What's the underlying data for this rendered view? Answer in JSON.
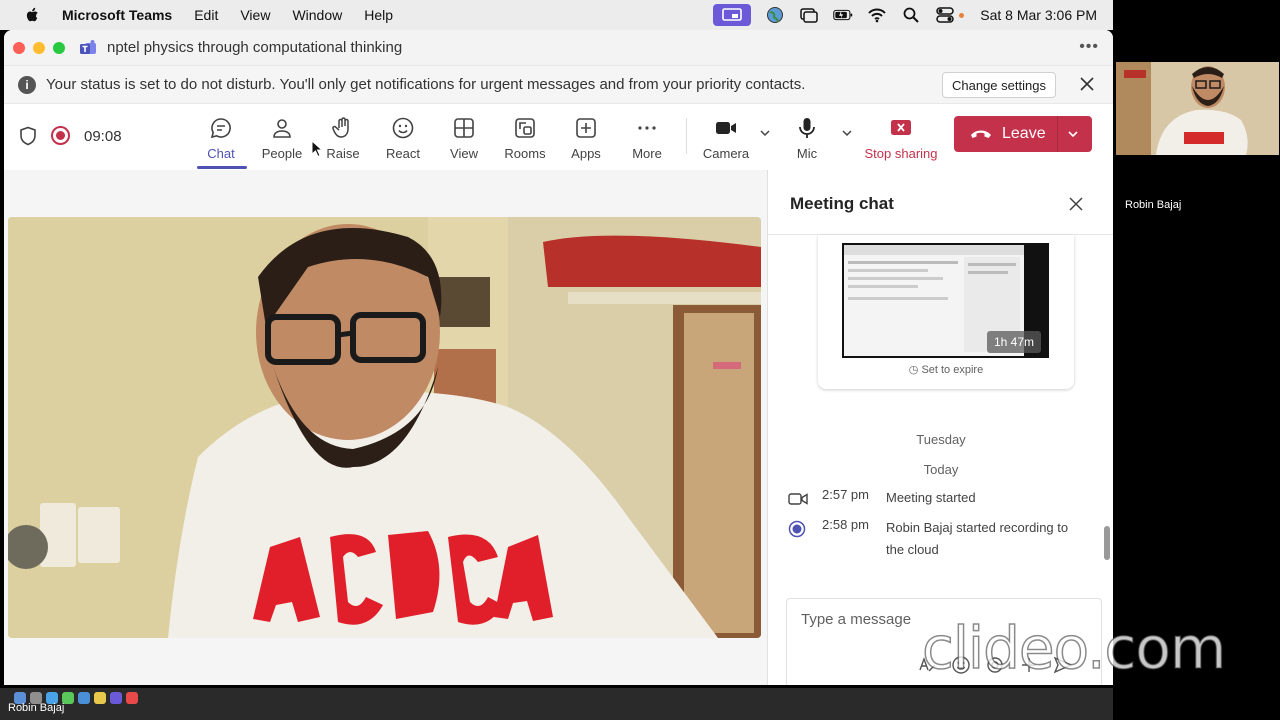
{
  "menubar": {
    "app_name": "Microsoft Teams",
    "items": [
      "Edit",
      "View",
      "Window",
      "Help"
    ],
    "clock": "Sat 8 Mar  3:06 PM"
  },
  "window": {
    "title": "nptel physics through computational thinking",
    "more": "•••"
  },
  "banner": {
    "text": "Your status is set to do not disturb. You'll only get notifications for urgent messages and from your priority contacts.",
    "change_settings": "Change settings"
  },
  "toolbar": {
    "timer": "09:08",
    "chat": "Chat",
    "people": "People",
    "raise": "Raise",
    "react": "React",
    "view": "View",
    "rooms": "Rooms",
    "apps": "Apps",
    "more": "More",
    "camera": "Camera",
    "mic": "Mic",
    "stop_sharing": "Stop sharing",
    "leave": "Leave"
  },
  "chat": {
    "title": "Meeting chat",
    "recording_duration": "1h 47m",
    "set_to_expire": "Set to expire",
    "day_1": "Tuesday",
    "day_2": "Today",
    "events": [
      {
        "time": "2:57 pm",
        "text": "Meeting started"
      },
      {
        "time": "2:58 pm",
        "text": "Robin Bajaj started recording to the cloud"
      }
    ],
    "compose_placeholder": "Type a message"
  },
  "participants": {
    "side_name": "Robin Bajaj",
    "dock_name": "Robin Bajaj"
  },
  "overlay": {
    "watermark": "clideo.com"
  },
  "colors": {
    "accent": "#4f52b2",
    "leave": "#c4314b",
    "dnd_badge": "#6a5ad8"
  }
}
